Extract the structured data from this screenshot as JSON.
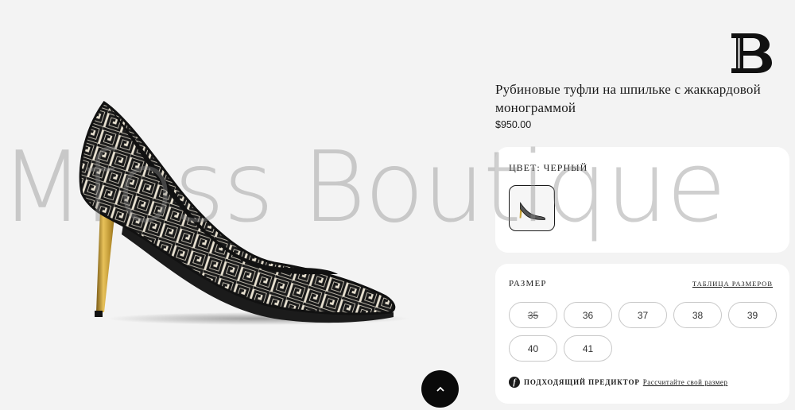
{
  "watermark": "Mfoss Boutique",
  "logo": {
    "icon": "balmain-b-logo"
  },
  "product": {
    "title": "Рубиновые туфли на шпильке с жаккардовой монограммой",
    "price": "$950.00"
  },
  "color": {
    "label": "ЦВЕТ: ЧЕРНЫЙ",
    "swatch_icon": "shoe-thumbnail-icon"
  },
  "size": {
    "label": "РАЗМЕР",
    "chart_link": "ТАБЛИЦА РАЗМЕРОВ",
    "options": [
      {
        "label": "35"
      },
      {
        "label": "36"
      },
      {
        "label": "37"
      },
      {
        "label": "38"
      },
      {
        "label": "39"
      },
      {
        "label": "40"
      },
      {
        "label": "41"
      }
    ],
    "unavailable": [
      "35"
    ],
    "predictor_icon": "f",
    "predictor_label": "ПОДХОДЯЩИЙ ПРЕДИКТОР",
    "predictor_link": "Рассчитайте свой размер"
  },
  "scroll_top": {
    "icon": "chevron-up-icon"
  },
  "colors": {
    "accent": "#0a0a0a",
    "background": "#f3f3f3",
    "gold_heel": "#c9a33a"
  }
}
